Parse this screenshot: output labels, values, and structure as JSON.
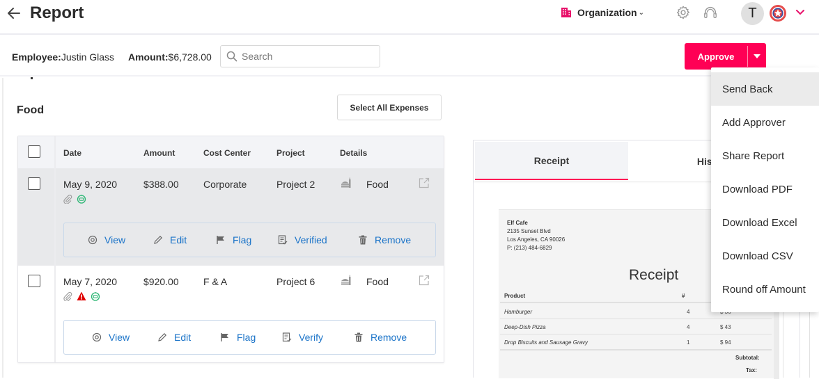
{
  "header": {
    "title": "Report",
    "org_label": "Organization",
    "user_initial": "T",
    "brand_color": "#ff0055"
  },
  "subheader": {
    "employee_label": "Employee:",
    "employee_value": "Justin Glass",
    "amount_label": "Amount:",
    "amount_value": "$6,728.00",
    "search_placeholder": "Search",
    "search_value": "",
    "approve_label": "Approve"
  },
  "section": {
    "title": "Food",
    "select_all_label": "Select All Expenses"
  },
  "table": {
    "columns": [
      "Date",
      "Amount",
      "Cost Center",
      "Project",
      "Details"
    ],
    "rows": [
      {
        "date": "May 9, 2020",
        "amount": "$388.00",
        "cost_center": "Corporate",
        "project": "Project 2",
        "details": "Food",
        "flags": [
          "attachment",
          "policy-ok"
        ],
        "actions": [
          "View",
          "Edit",
          "Flag",
          "Verified",
          "Remove"
        ]
      },
      {
        "date": "May 7, 2020",
        "amount": "$920.00",
        "cost_center": "F & A",
        "project": "Project 6",
        "details": "Food",
        "flags": [
          "attachment",
          "warning",
          "policy-ok"
        ],
        "actions": [
          "View",
          "Edit",
          "Flag",
          "Verify",
          "Remove"
        ]
      }
    ]
  },
  "receipt_panel": {
    "tabs": [
      "Receipt",
      "History"
    ],
    "active_tab": "Receipt",
    "receipt": {
      "merchant": "Elf Cafe",
      "address1": "2135 Sunset Blvd",
      "address2": "Los Angeles, CA 90026",
      "phone": "P: (213) 484-6829",
      "title": "Receipt",
      "col_product": "Product",
      "col_qty": "#",
      "items": [
        {
          "name": "Hamburger",
          "qty": "4",
          "price": "$ 36"
        },
        {
          "name": "Deep-Dish Pizza",
          "qty": "4",
          "price": "$ 43"
        },
        {
          "name": "Drop Biscuits and Sausage Gravy",
          "qty": "1",
          "price": "$ 94"
        }
      ],
      "subtotal_label": "Subtotal:",
      "tax_label": "Tax:"
    }
  },
  "approve_menu": {
    "items": [
      "Send Back",
      "Add Approver",
      "Share Report",
      "Download PDF",
      "Download Excel",
      "Download CSV",
      "Round off Amount"
    ],
    "highlighted": "Send Back"
  }
}
